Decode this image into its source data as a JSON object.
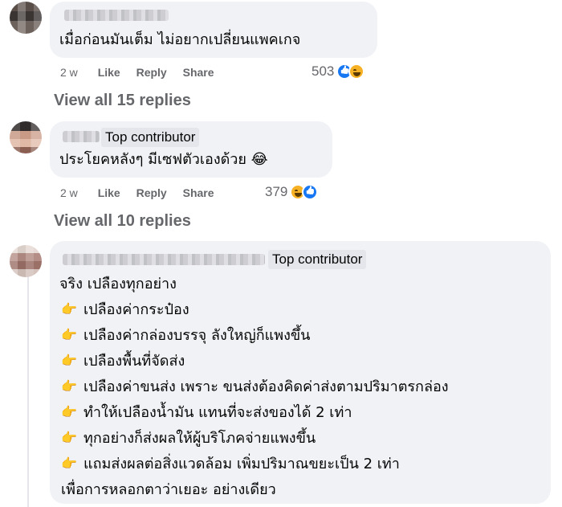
{
  "comments": [
    {
      "text": "เมื่อก่อนมันเต็ม ไม่อยากเปลี่ยนแพคเกจ",
      "time": "2 w",
      "like_label": "Like",
      "reply_label": "Reply",
      "share_label": "Share",
      "reaction_count": "503",
      "view_replies": "View all 15 replies"
    },
    {
      "badge": "Top contributor",
      "text": "ประโยคหลังๆ มีเซฟตัวเองด้วย 😂",
      "time": "2 w",
      "like_label": "Like",
      "reply_label": "Reply",
      "share_label": "Share",
      "reaction_count": "379",
      "view_replies": "View all 10 replies"
    },
    {
      "badge": "Top contributor",
      "intro": "จริง เปลืองทุกอย่าง",
      "points": [
        "เปลืองค่ากระป๋อง",
        "เปลืองค่ากล่องบรรจุ ลังใหญ่ก็แพงขึ้น",
        "เปลืองพื้นที่จัดส่ง",
        "เปลืองค่าขนส่ง เพราะ ขนส่งต้องคิดค่าส่งตามปริมาตรกล่อง",
        "ทำให้เปลืองน้ำมัน แทนที่จะส่งของได้ 2 เท่า",
        "ทุกอย่างก็ส่งผลให้ผู้บริโภคจ่ายแพงขึ้น",
        "แถมส่งผลต่อสิ่งแวดล้อม เพิ่มปริมาณขยะเป็น 2 เท่า"
      ],
      "closing": "เพื่อการหลอกตาว่าเยอะ อย่างเดียว"
    }
  ],
  "icons": {
    "point": "backhand-index-pointing-right",
    "reactions": [
      "like",
      "haha"
    ]
  },
  "colors": {
    "bubble": "#f0f2f5",
    "meta": "#65676b",
    "like_blue": "#1877f2",
    "haha_yellow": "#f7b125"
  }
}
